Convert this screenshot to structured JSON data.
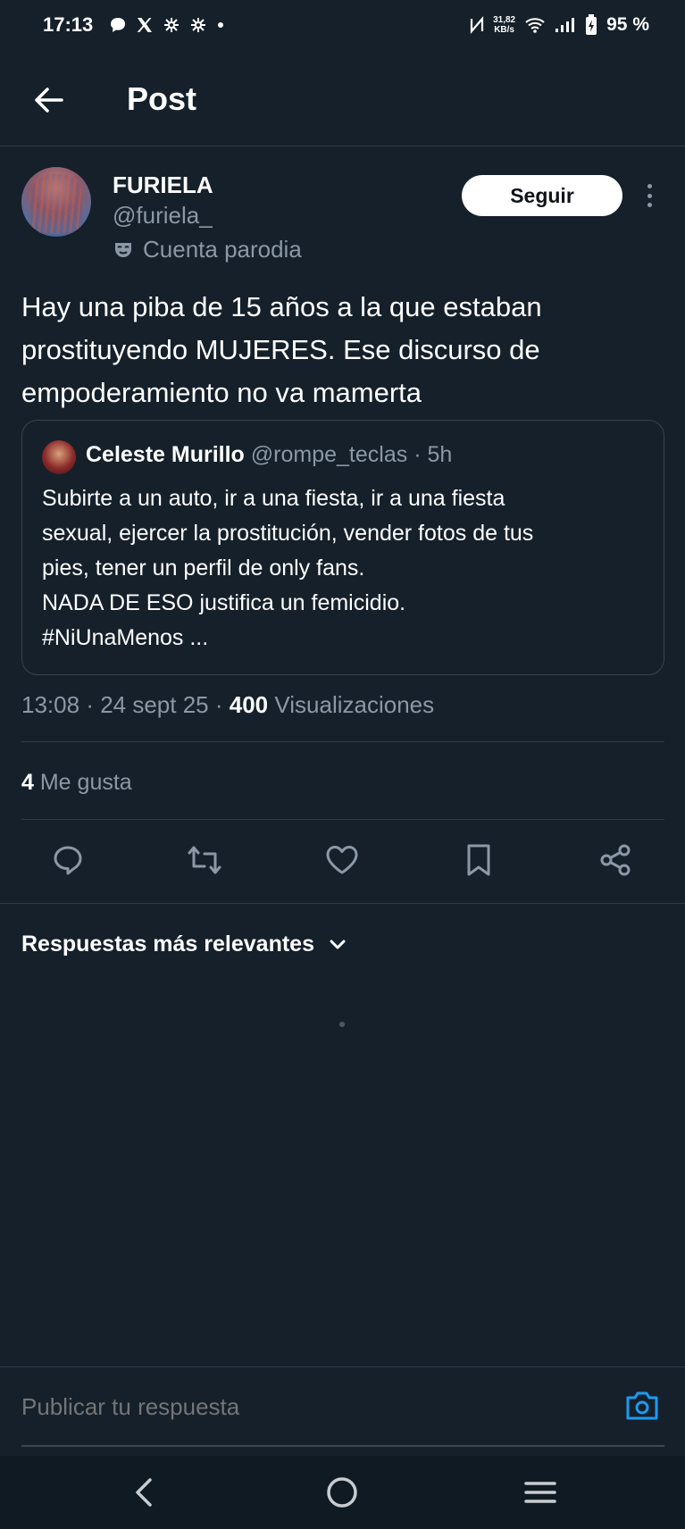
{
  "status_bar": {
    "time": "17:13",
    "notification_icons": [
      "chat-bubble-icon",
      "x-logo-icon",
      "threads-icon",
      "threads-icon",
      "dot-icon"
    ],
    "speed_value": "31,82",
    "speed_unit": "KB/s",
    "battery": "95 %"
  },
  "header": {
    "title": "Post"
  },
  "post": {
    "author_name": "FURIELA",
    "author_handle": "@furiela_",
    "parody_label": "Cuenta parodia",
    "follow_label": "Seguir",
    "text": "Hay una piba de 15 años a la que estaban prostituyendo MUJERES.  Ese discurso de empoderamiento no va mamerta",
    "quote": {
      "name": "Celeste Murillo",
      "handle": "@rompe_teclas",
      "time": "· 5h",
      "lines": [
        "Subirte a un auto, ir a una fiesta, ir a una fiesta",
        "sexual, ejercer la prostitución, vender fotos de tus",
        "pies, tener un perfil de only fans.",
        "NADA DE ESO justifica un femicidio.",
        "#NiUnaMenos ..."
      ]
    },
    "meta": {
      "time": "13:08",
      "date": "24 sept 25",
      "views_count": "400",
      "views_label": "Visualizaciones"
    },
    "likes": {
      "count": "4",
      "label": "Me gusta"
    }
  },
  "replies": {
    "sort_label": "Respuestas más relevantes"
  },
  "reply_bar": {
    "placeholder": "Publicar tu respuesta"
  },
  "colors": {
    "background": "#15202b",
    "muted": "#8b98a5",
    "accent": "#1d9bf0",
    "divider": "#2f3c49"
  }
}
